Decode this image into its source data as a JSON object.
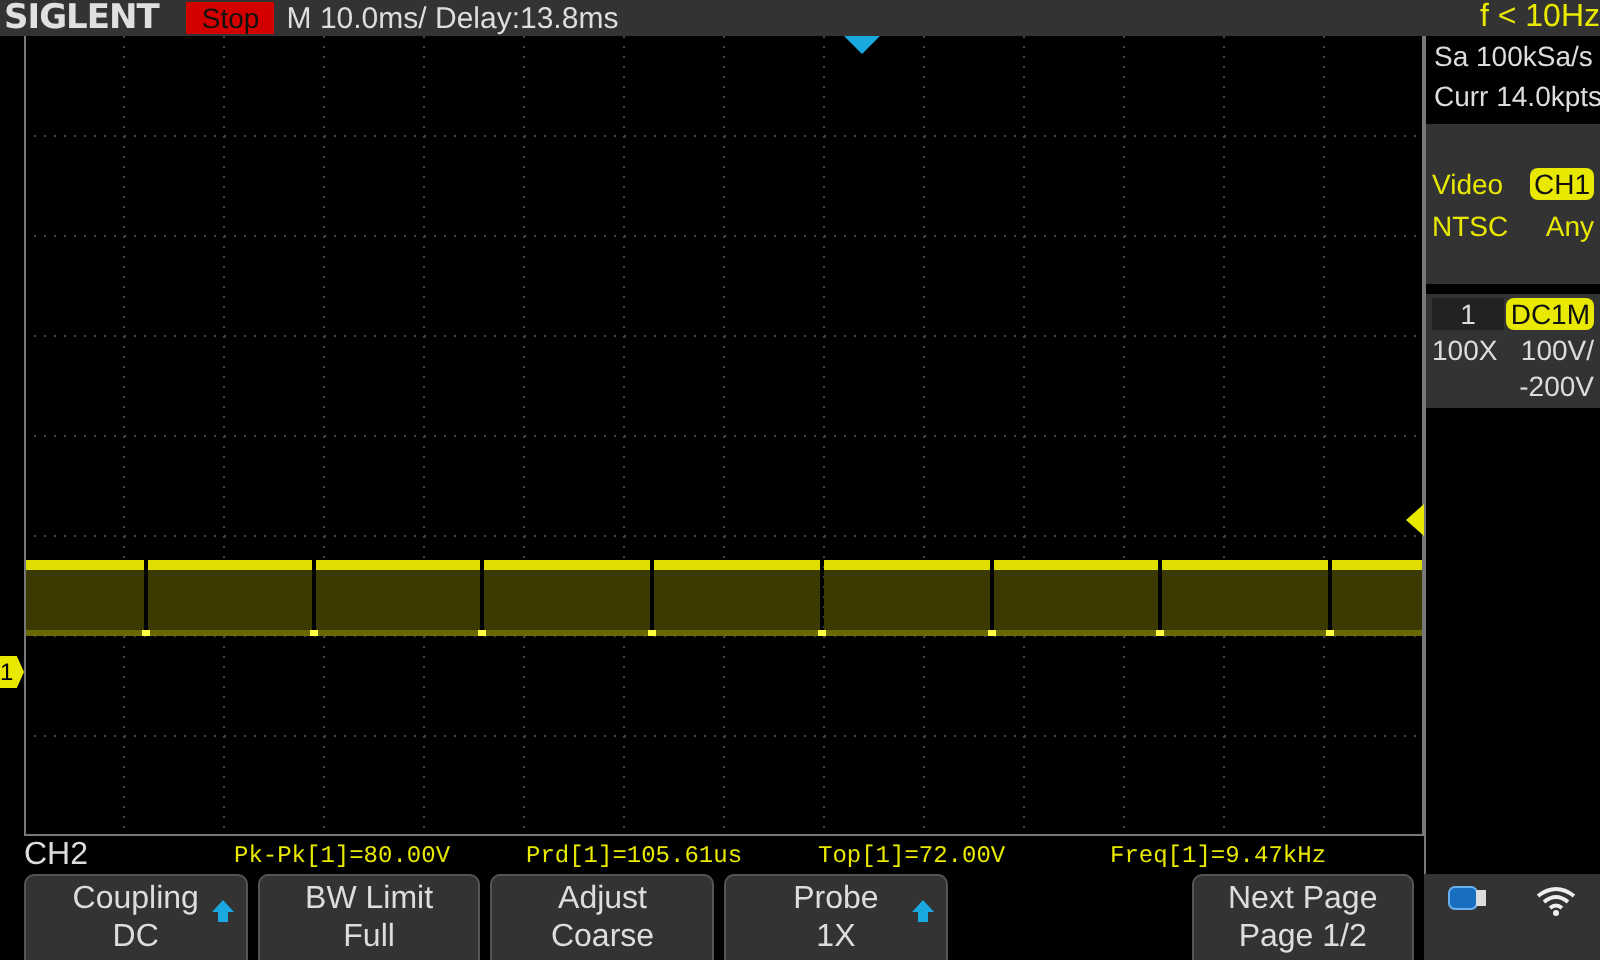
{
  "header": {
    "brand": "SIGLENT",
    "run_state": {
      "label": "Stop",
      "kind": "stop"
    },
    "timebase": "M 10.0ms/ Delay:13.8ms",
    "frequency": "f < 10Hz"
  },
  "side_panel": {
    "sample_rate": "Sa 100kSa/s",
    "memory": "Curr 14.0kpts",
    "trigger": {
      "type": "Video",
      "source": "CH1",
      "standard": "NTSC",
      "sync": "Any"
    },
    "channel": {
      "number": "1",
      "coupling": "DC1M",
      "probe": "100X",
      "scale": "100V/",
      "offset": "-200V"
    }
  },
  "plot": {
    "channel_marker": "1"
  },
  "measurements": {
    "channel": "CH2",
    "items": [
      "Pk-Pk[1]=80.00V",
      "Prd[1]=105.61us",
      "Top[1]=72.00V",
      "Freq[1]=9.47kHz"
    ]
  },
  "softkeys": [
    {
      "kind": "option",
      "label": "Coupling",
      "value": "DC",
      "arrow": true
    },
    {
      "kind": "option",
      "label": "BW Limit",
      "value": "Full",
      "arrow": false
    },
    {
      "kind": "option",
      "label": "Adjust",
      "value": "Coarse",
      "arrow": false
    },
    {
      "kind": "option",
      "label": "Probe",
      "value": "1X",
      "arrow": true
    },
    {
      "kind": "blank"
    },
    {
      "kind": "option",
      "label": "Next Page",
      "value": "Page 1/2",
      "arrow": false
    }
  ]
}
